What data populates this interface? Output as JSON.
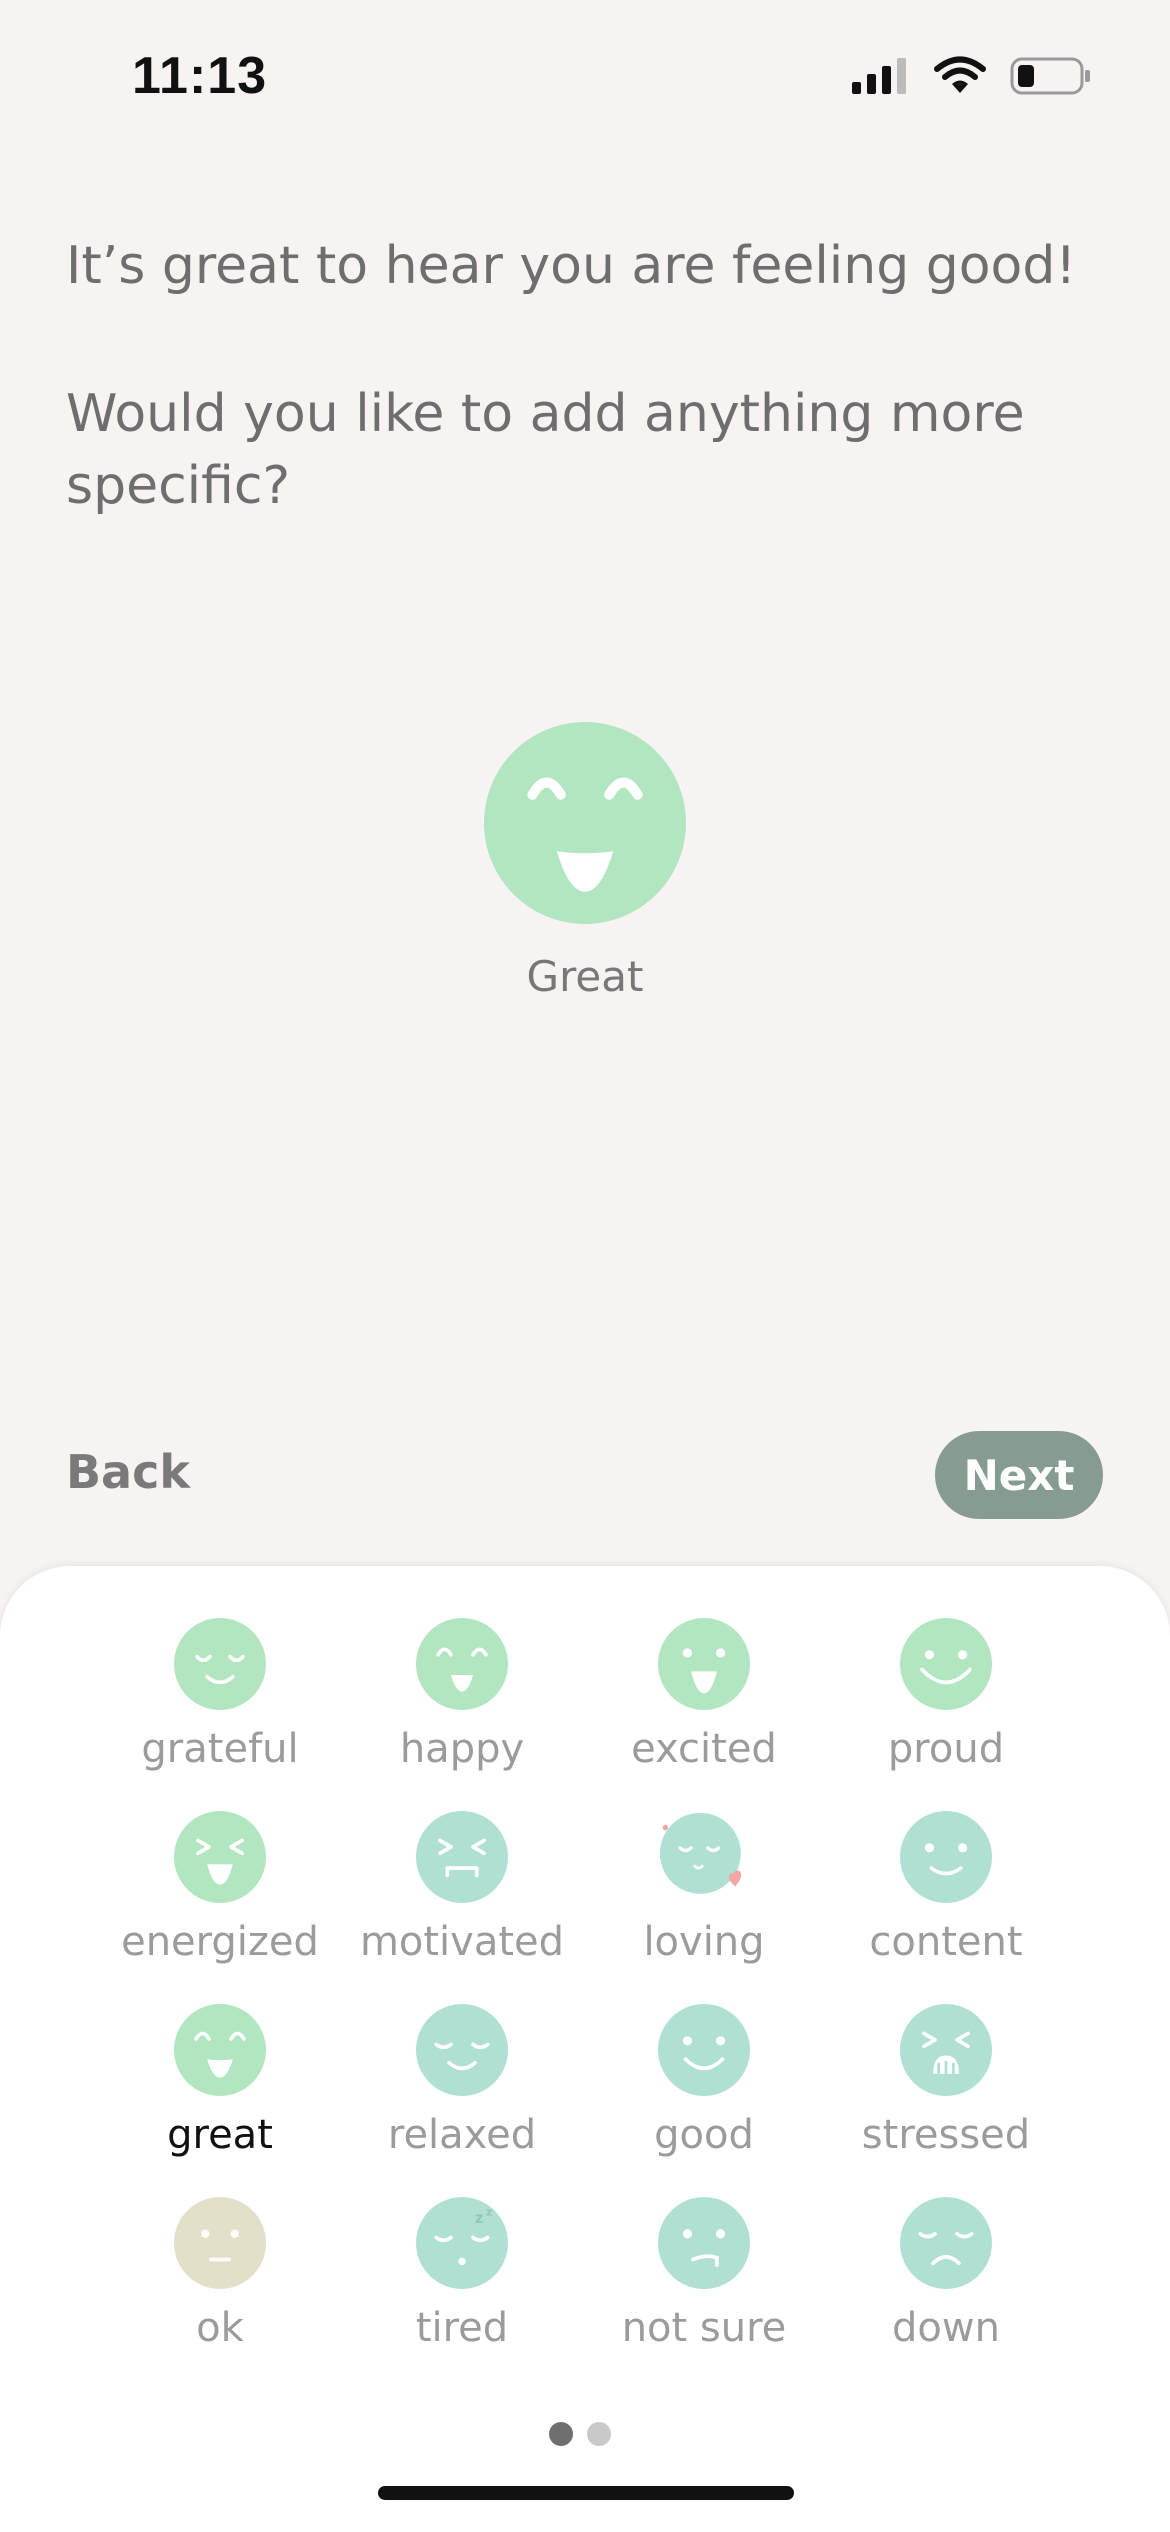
{
  "status_bar": {
    "time": "11:13"
  },
  "prompt": {
    "line1": "It’s great to hear you are feeling good!",
    "line2": "Would you like to add anything more specific?"
  },
  "selected": {
    "label": "Great",
    "color": "#b2e6c1"
  },
  "nav": {
    "back_label": "Back",
    "next_label": "Next"
  },
  "emotions": [
    {
      "label": "grateful",
      "color": "#b2e6c1"
    },
    {
      "label": "happy",
      "color": "#b2e6c1"
    },
    {
      "label": "excited",
      "color": "#b2e6c1"
    },
    {
      "label": "proud",
      "color": "#b2e6c1"
    },
    {
      "label": "energized",
      "color": "#b2e6c1"
    },
    {
      "label": "motivated",
      "color": "#b0e0d4"
    },
    {
      "label": "loving",
      "color": "#b0e0d4"
    },
    {
      "label": "content",
      "color": "#b0e0d4"
    },
    {
      "label": "great",
      "color": "#b2e6c1",
      "selected": true
    },
    {
      "label": "relaxed",
      "color": "#b0e0d4"
    },
    {
      "label": "good",
      "color": "#b0e0d4"
    },
    {
      "label": "stressed",
      "color": "#b0e0d4"
    },
    {
      "label": "ok",
      "color": "#e3e0ca"
    },
    {
      "label": "tired",
      "color": "#b0e0d4"
    },
    {
      "label": "not sure",
      "color": "#b0e0d4"
    },
    {
      "label": "down",
      "color": "#b0e0d4"
    }
  ],
  "pager": {
    "pages": 2,
    "current": 1
  }
}
